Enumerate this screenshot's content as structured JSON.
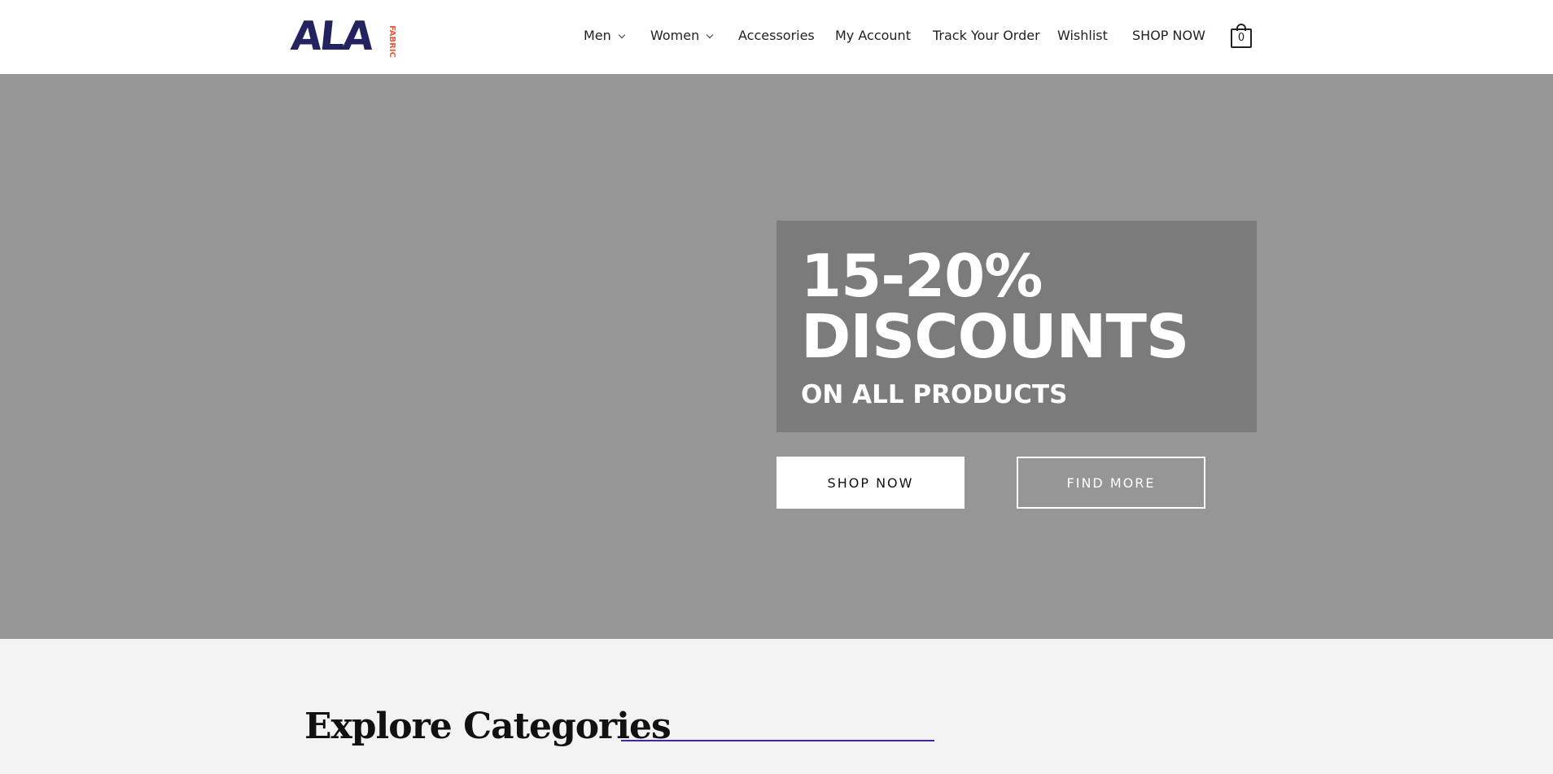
{
  "header": {
    "logo": {
      "main": "ALA",
      "sub": "FABRIC"
    },
    "nav": [
      {
        "label": "Men",
        "has_dropdown": true
      },
      {
        "label": "Women",
        "has_dropdown": true
      },
      {
        "label": "Accessories",
        "has_dropdown": false
      },
      {
        "label": "My Account",
        "has_dropdown": false
      },
      {
        "label": "Track Your Order",
        "has_dropdown": false
      },
      {
        "label": "Wishlist",
        "has_dropdown": false
      },
      {
        "label": "SHOP NOW",
        "has_dropdown": false
      }
    ],
    "cart": {
      "count": "0",
      "icon": "shopping-bag-icon"
    }
  },
  "hero": {
    "headline_line1": "15-20%",
    "headline_line2": "DISCOUNTS",
    "subheadline": "ON ALL PRODUCTS",
    "primary_button": "SHOP NOW",
    "secondary_button": "FIND MORE"
  },
  "categories": {
    "title": "Explore Categories"
  },
  "colors": {
    "brand_navy": "#23235f",
    "brand_orange": "#ee5a3b",
    "hero_bg": "#969696",
    "promo_box": "#7b7b7b",
    "accent_line": "#3f1fd0",
    "section_bg": "#f3f3f3"
  }
}
